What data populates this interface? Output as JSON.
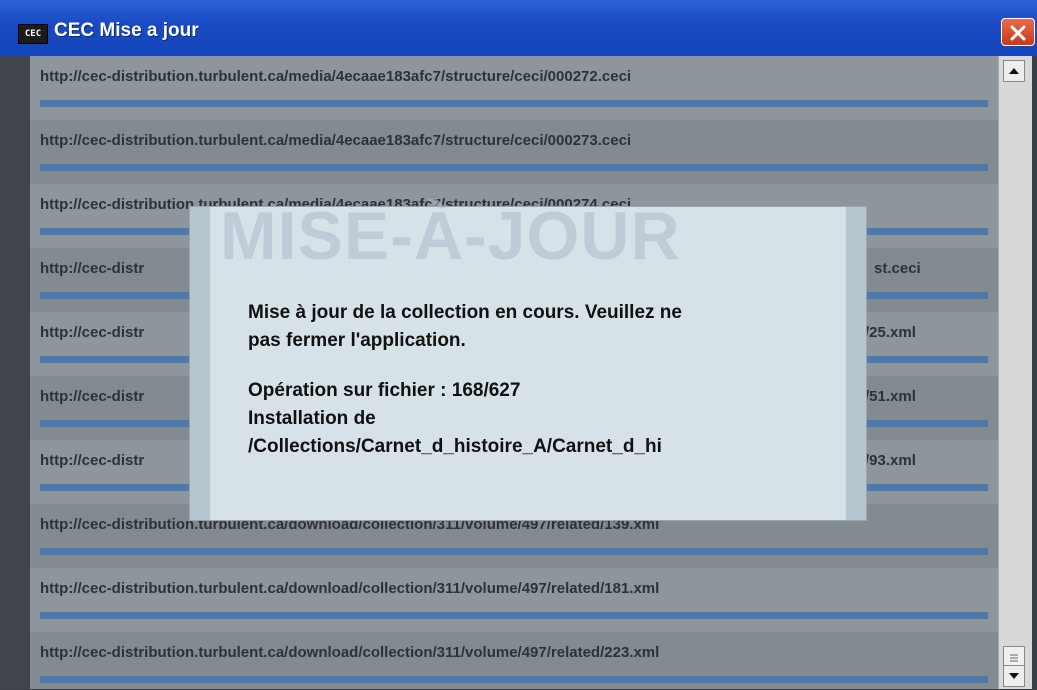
{
  "window": {
    "title": "CEC Mise a jour",
    "icon_text": "CEC",
    "icon": "app-logo-icon",
    "close_icon": "close-icon"
  },
  "colors": {
    "titlebar": "#1a4bc4",
    "close": "#d9482a",
    "progress": "#4a7aab",
    "overlay_bg": "#d7e1e8"
  },
  "downloads": [
    {
      "url": "http://cec-distribution.turbulent.ca/media/4ecaae183afc7/structure/ceci/000272.ceci",
      "progress": 1.0
    },
    {
      "url": "http://cec-distribution.turbulent.ca/media/4ecaae183afc7/structure/ceci/000273.ceci",
      "progress": 1.0
    },
    {
      "url": "http://cec-distribution.turbulent.ca/media/4ecaae183afc7/structure/ceci/000274.ceci",
      "progress": 1.0
    },
    {
      "url": "http://cec-distr",
      "url_end": "st.ceci",
      "progress": 1.0
    },
    {
      "url": "http://cec-distr",
      "url_end": "/25.xml",
      "progress": 1.0
    },
    {
      "url": "http://cec-distr",
      "url_end": "/51.xml",
      "progress": 1.0
    },
    {
      "url": "http://cec-distr",
      "url_end": "/93.xml",
      "progress": 1.0
    },
    {
      "url": "http://cec-distribution.turbulent.ca/download/collection/311/volume/497/related/139.xml",
      "progress": 1.0
    },
    {
      "url": "http://cec-distribution.turbulent.ca/download/collection/311/volume/497/related/181.xml",
      "progress": 1.0
    },
    {
      "url": "http://cec-distribution.turbulent.ca/download/collection/311/volume/497/related/223.xml",
      "progress": 1.0
    }
  ],
  "dialog": {
    "watermark": "MISE-À-JOUR",
    "line1": "Mise à jour de la collection en cours. Veuillez ne",
    "line2": "pas fermer l'application.",
    "operation": "Opération sur fichier : 168/627",
    "install_label": "Installation de",
    "install_path": "/Collections/Carnet_d_histoire_A/Carnet_d_hi"
  }
}
